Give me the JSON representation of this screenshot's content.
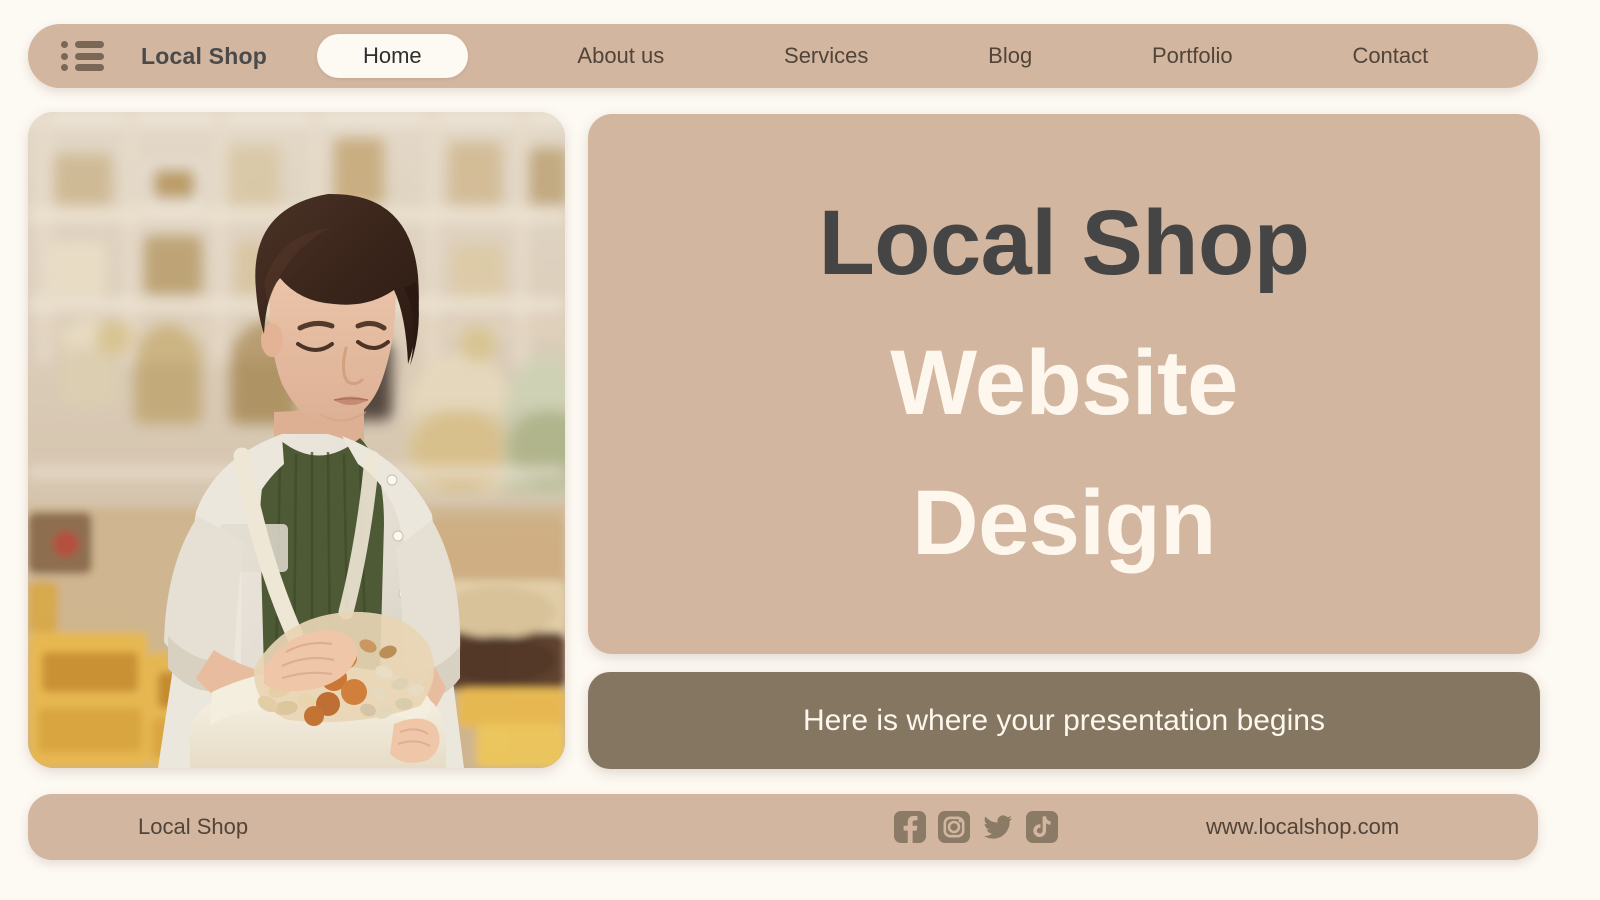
{
  "theme": {
    "background": "#fdf9f3",
    "accent": "#d3b69f",
    "dark_accent": "#857661",
    "text_dark": "#454545",
    "text_light": "#fdf7ee",
    "icon_color": "#7b6755"
  },
  "navbar": {
    "menu_icon": "list-menu-icon",
    "brand": "Local Shop",
    "items": [
      {
        "label": "Home",
        "active": true
      },
      {
        "label": "About us",
        "active": false
      },
      {
        "label": "Services",
        "active": false
      },
      {
        "label": "Blog",
        "active": false
      },
      {
        "label": "Portfolio",
        "active": false
      },
      {
        "label": "Contact",
        "active": false
      }
    ]
  },
  "photo": {
    "alt": "Woman shopping in a bulk-food local shop putting nuts and dried fruit into a cloth tote bag"
  },
  "hero": {
    "line1": "Local Shop",
    "line2": "Website",
    "line3": "Design"
  },
  "subtitle": {
    "text": "Here is where your presentation begins"
  },
  "footer": {
    "brand": "Local Shop",
    "url": "www.localshop.com",
    "socials": [
      {
        "name": "facebook-icon",
        "label": "Facebook"
      },
      {
        "name": "instagram-icon",
        "label": "Instagram"
      },
      {
        "name": "twitter-icon",
        "label": "Twitter"
      },
      {
        "name": "tiktok-icon",
        "label": "TikTok"
      }
    ]
  }
}
